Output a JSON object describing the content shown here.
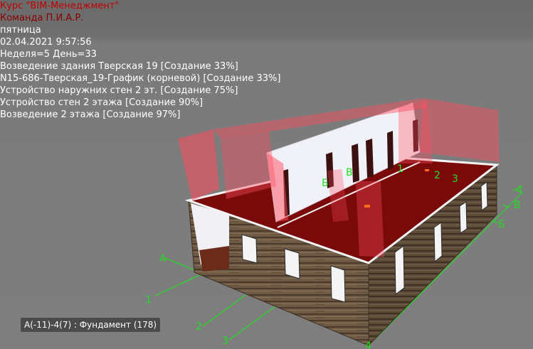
{
  "hud": {
    "course_title": "Курс \"BIM-Менеджмент\"",
    "team": "Команда П.И.А.Р.",
    "weekday": "пятница",
    "datetime": "02.04.2021 9:57:56",
    "week_day": "Неделя=5 День=33",
    "tasks": [
      "Возведение здания Тверская 19 [Создание 33%]",
      "N15-686-Тверская_19-График (корневой) [Создание 33%]",
      "Устройство наружних стен 2 эт. [Создание 75%]",
      "Устройство стен 2 этажа [Создание 90%]",
      "Возведение 2 этажа [Создание 97%]"
    ]
  },
  "axes": {
    "color": "#22dd22",
    "left": [
      "А",
      "1",
      "2",
      "3"
    ],
    "far": [
      "Б",
      "В",
      "1",
      "2",
      "3"
    ],
    "right": [
      "4",
      "В",
      "Б"
    ],
    "bottom": "4"
  },
  "status": {
    "label": "А(-11)-4(7) : Фундамент (178)"
  },
  "colors": {
    "background": "#7a7a7a",
    "log_wall": "#6e5a45",
    "slab": "#7a0a0a",
    "transparent_wall": "#ff4d5e",
    "course_text": "#c00000",
    "info_text": "#ffffff"
  }
}
